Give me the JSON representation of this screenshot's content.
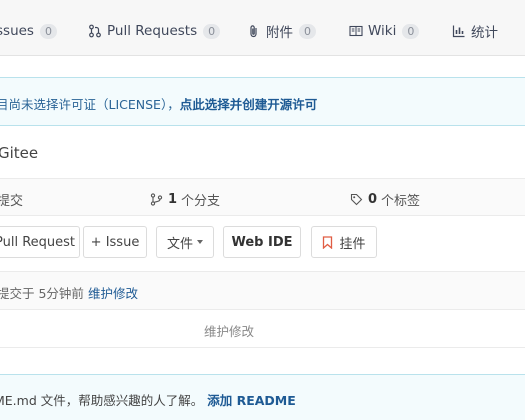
{
  "tabs": [
    {
      "label": "ssues",
      "count": "0",
      "icon": "issues-icon"
    },
    {
      "label": "Pull Requests",
      "count": "0",
      "icon": "pull-request-icon"
    },
    {
      "label": "附件",
      "count": "0",
      "icon": "paperclip-icon"
    },
    {
      "label": "Wiki",
      "count": "0",
      "icon": "book-icon"
    },
    {
      "label": "统计",
      "icon": "bar-chart-icon"
    }
  ],
  "license_notice": {
    "text": "目尚未选择许可证（LICENSE），",
    "action": "点此选择并创建开源许可"
  },
  "description": "Gitee",
  "stats": {
    "commits_label": "提交",
    "branches_count": "1",
    "branches_label": "个分支",
    "tags_count": "0",
    "tags_label": "个标签"
  },
  "toolbar": {
    "pull_request": "Pull Request",
    "issue": "+ Issue",
    "file": "文件",
    "web_ide": "Web IDE",
    "widget": "挂件"
  },
  "latest_commit": {
    "text": "提交于 5分钟前",
    "message_link": "维护修改"
  },
  "file_row": {
    "message": "维护修改"
  },
  "readme_notice": {
    "text": "ME.md 文件，帮助感兴趣的人了解。",
    "action": "添加 README"
  },
  "colors": {
    "link": "#1e5a94",
    "notice_bg": "#f3fbfd",
    "notice_border": "#b9e2ec",
    "widget_icon": "#e05d44"
  }
}
